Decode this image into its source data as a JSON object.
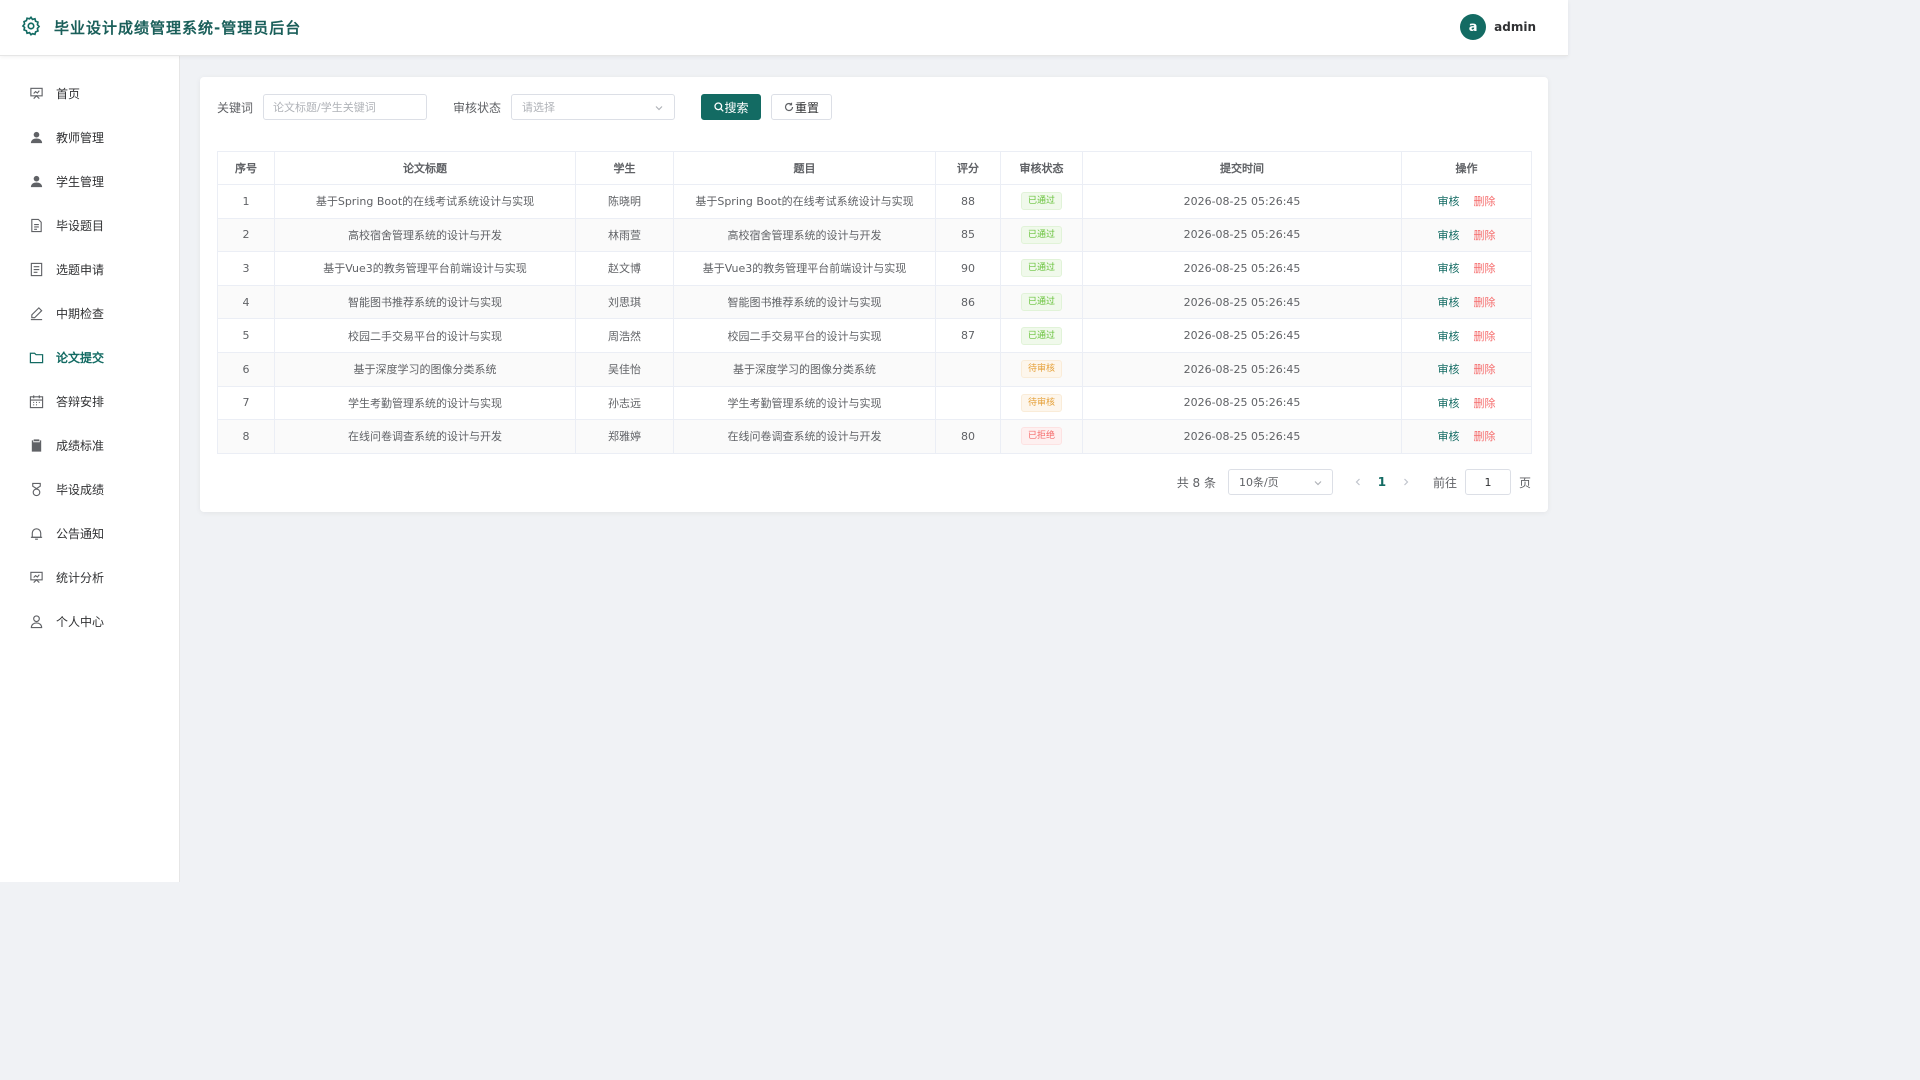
{
  "app": {
    "title": "毕业设计成绩管理系统-管理员后台",
    "logo_icon": "gear-icon"
  },
  "user": {
    "avatar_letter": "a",
    "name": "admin",
    "avatar_color": "#136b63"
  },
  "theme": {
    "primary": "#136b63",
    "danger": "#f56c6c",
    "success": "#67c23a",
    "warning": "#e6a23c"
  },
  "sidebar": {
    "items": [
      {
        "label": "首页",
        "icon": "dashboard-icon",
        "active": false
      },
      {
        "label": "教师管理",
        "icon": "user-icon",
        "active": false
      },
      {
        "label": "学生管理",
        "icon": "user-icon",
        "active": false
      },
      {
        "label": "毕设题目",
        "icon": "document-icon",
        "active": false
      },
      {
        "label": "选题申请",
        "icon": "list-icon",
        "active": false
      },
      {
        "label": "中期检查",
        "icon": "edit-pen-icon",
        "active": false
      },
      {
        "label": "论文提交",
        "icon": "folder-icon",
        "active": true
      },
      {
        "label": "答辩安排",
        "icon": "calendar-icon",
        "active": false
      },
      {
        "label": "成绩标准",
        "icon": "clipboard-icon",
        "active": false
      },
      {
        "label": "毕设成绩",
        "icon": "medal-icon",
        "active": false
      },
      {
        "label": "公告通知",
        "icon": "bell-icon",
        "active": false
      },
      {
        "label": "统计分析",
        "icon": "chart-icon",
        "active": false
      },
      {
        "label": "个人中心",
        "icon": "person-icon",
        "active": false
      }
    ]
  },
  "filter": {
    "keyword_label": "关键词",
    "keyword_placeholder": "论文标题/学生关键词",
    "keyword_value": "",
    "status_label": "审核状态",
    "status_placeholder": "请选择",
    "search_label": "搜索",
    "reset_label": "重置"
  },
  "table": {
    "headers": {
      "index": "序号",
      "title": "论文标题",
      "student": "学生",
      "topic": "题目",
      "score": "评分",
      "status": "审核状态",
      "time": "提交时间",
      "actions": "操作"
    },
    "review_label": "审核",
    "delete_label": "删除",
    "rows": [
      {
        "index": "1",
        "title": "基于Spring Boot的在线考试系统设计与实现",
        "student": "陈晓明",
        "topic": "基于Spring Boot的在线考试系统设计与实现",
        "score": "88",
        "status": "已通过",
        "status_type": "success",
        "time": "2026-08-25 05:26:45"
      },
      {
        "index": "2",
        "title": "高校宿舍管理系统的设计与开发",
        "student": "林雨萱",
        "topic": "高校宿舍管理系统的设计与开发",
        "score": "85",
        "status": "已通过",
        "status_type": "success",
        "time": "2026-08-25 05:26:45"
      },
      {
        "index": "3",
        "title": "基于Vue3的教务管理平台前端设计与实现",
        "student": "赵文博",
        "topic": "基于Vue3的教务管理平台前端设计与实现",
        "score": "90",
        "status": "已通过",
        "status_type": "success",
        "time": "2026-08-25 05:26:45"
      },
      {
        "index": "4",
        "title": "智能图书推荐系统的设计与实现",
        "student": "刘思琪",
        "topic": "智能图书推荐系统的设计与实现",
        "score": "86",
        "status": "已通过",
        "status_type": "success",
        "time": "2026-08-25 05:26:45"
      },
      {
        "index": "5",
        "title": "校园二手交易平台的设计与实现",
        "student": "周浩然",
        "topic": "校园二手交易平台的设计与实现",
        "score": "87",
        "status": "已通过",
        "status_type": "success",
        "time": "2026-08-25 05:26:45"
      },
      {
        "index": "6",
        "title": "基于深度学习的图像分类系统",
        "student": "吴佳怡",
        "topic": "基于深度学习的图像分类系统",
        "score": "",
        "status": "待审核",
        "status_type": "warning",
        "time": "2026-08-25 05:26:45"
      },
      {
        "index": "7",
        "title": "学生考勤管理系统的设计与实现",
        "student": "孙志远",
        "topic": "学生考勤管理系统的设计与实现",
        "score": "",
        "status": "待审核",
        "status_type": "warning",
        "time": "2026-08-25 05:26:45"
      },
      {
        "index": "8",
        "title": "在线问卷调查系统的设计与开发",
        "student": "郑雅婷",
        "topic": "在线问卷调查系统的设计与开发",
        "score": "80",
        "status": "已拒绝",
        "status_type": "danger",
        "time": "2026-08-25 05:26:45"
      }
    ]
  },
  "pagination": {
    "total_text": "共 8 条",
    "page_size": "10条/页",
    "current_page": "1",
    "goto_label": "前往",
    "goto_value": "1",
    "page_suffix": "页"
  }
}
